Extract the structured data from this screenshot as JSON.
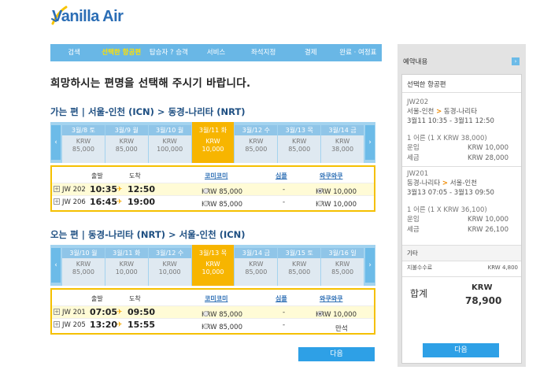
{
  "brand": {
    "logo_text": "Vanilla Air",
    "primary": "#69b7e6",
    "accent": "#f7b500"
  },
  "steps": [
    {
      "label": "검색",
      "active": false
    },
    {
      "label": "선택한 항공편",
      "active": true
    },
    {
      "label": "탑승자 ? 승객",
      "active": false
    },
    {
      "label": "서비스",
      "active": false
    },
    {
      "label": "좌석지정",
      "active": false
    },
    {
      "label": "결제",
      "active": false
    },
    {
      "label": "완료 · 여정표",
      "active": false
    }
  ],
  "page_title": "희망하시는 편명을 선택해 주시기 바랍니다.",
  "outbound": {
    "prefix": "가는 편 |",
    "route": "서울-인천 (ICN) > 동경-나리타 (NRT)",
    "dates": [
      {
        "date": "3월/8 토",
        "cur": "KRW",
        "price": "85,000",
        "selected": false
      },
      {
        "date": "3월/9 월",
        "cur": "KRW",
        "price": "85,000",
        "selected": false
      },
      {
        "date": "3월/10 월",
        "cur": "KRW",
        "price": "100,000",
        "selected": false
      },
      {
        "date": "3월/11 화",
        "cur": "KRW",
        "price": "10,000",
        "selected": true
      },
      {
        "date": "3월/12 수",
        "cur": "KRW",
        "price": "85,000",
        "selected": false
      },
      {
        "date": "3월/13 목",
        "cur": "KRW",
        "price": "85,000",
        "selected": false
      },
      {
        "date": "3월/14 금",
        "cur": "KRW",
        "price": "38,000",
        "selected": false
      }
    ],
    "headers": {
      "dep": "출발",
      "arr": "도착",
      "fare1": "코미코미",
      "fare2": "심플",
      "fare3": "와쿠와쿠"
    },
    "flights": [
      {
        "no": "JW 202",
        "dep": "10:35",
        "arr": "12:50",
        "fare1": "KRW 85,000",
        "fare2": "-",
        "fare3": "KRW 10,000",
        "sel": 3
      },
      {
        "no": "JW 206",
        "dep": "16:45",
        "arr": "19:00",
        "fare1": "KRW 85,000",
        "fare2": "-",
        "fare3": "KRW 10,000",
        "sel": 0
      }
    ]
  },
  "inbound": {
    "prefix": "오는 편 |",
    "route": "동경-나리타 (NRT) > 서울-인천 (ICN)",
    "dates": [
      {
        "date": "3월/10 월",
        "cur": "KRW",
        "price": "85,000",
        "selected": false
      },
      {
        "date": "3월/11 화",
        "cur": "KRW",
        "price": "10,000",
        "selected": false
      },
      {
        "date": "3월/12 수",
        "cur": "KRW",
        "price": "10,000",
        "selected": false
      },
      {
        "date": "3월/13 목",
        "cur": "KRW",
        "price": "10,000",
        "selected": true
      },
      {
        "date": "3월/14 금",
        "cur": "KRW",
        "price": "85,000",
        "selected": false
      },
      {
        "date": "3월/15 토",
        "cur": "KRW",
        "price": "85,000",
        "selected": false
      },
      {
        "date": "3월/16 일",
        "cur": "KRW",
        "price": "85,000",
        "selected": false
      }
    ],
    "headers": {
      "dep": "출발",
      "arr": "도착",
      "fare1": "코미코미",
      "fare2": "심플",
      "fare3": "와쿠와쿠"
    },
    "flights": [
      {
        "no": "JW 201",
        "dep": "07:05",
        "arr": "09:50",
        "fare1": "KRW 85,000",
        "fare2": "-",
        "fare3": "KRW 10,000",
        "sel": 3
      },
      {
        "no": "JW 205",
        "dep": "13:20",
        "arr": "15:55",
        "fare1": "KRW 85,000",
        "fare2": "-",
        "fare3": "만석",
        "sel": 0
      }
    ]
  },
  "next_label": "다음",
  "sidebar": {
    "title": "예약내용",
    "toggle": "›",
    "panel_title": "선택한 항공편",
    "leg1": {
      "flight": "JW202",
      "from": "서울-인천",
      "to": "동경-나리타",
      "time": "3월11 10:35 - 3월11 12:50",
      "pax": "1 어른 (1 X KRW 38,000)",
      "fare_label": "운임",
      "fare": "KRW 10,000",
      "tax_label": "세금",
      "tax": "KRW 28,000"
    },
    "leg2": {
      "flight": "JW201",
      "from": "동경-나리타",
      "to": "서울-인천",
      "time": "3월13 07:05 - 3월13 09:50",
      "pax": "1 어른 (1 X KRW 36,100)",
      "fare_label": "운임",
      "fare": "KRW 10,000",
      "tax_label": "세금",
      "tax": "KRW 26,100"
    },
    "etc_title": "기타",
    "fee_label": "지불수수료",
    "fee": "KRW 4,800",
    "total_label": "합계",
    "total_cur": "KRW",
    "total_amount": "78,900",
    "next_label": "다음"
  }
}
